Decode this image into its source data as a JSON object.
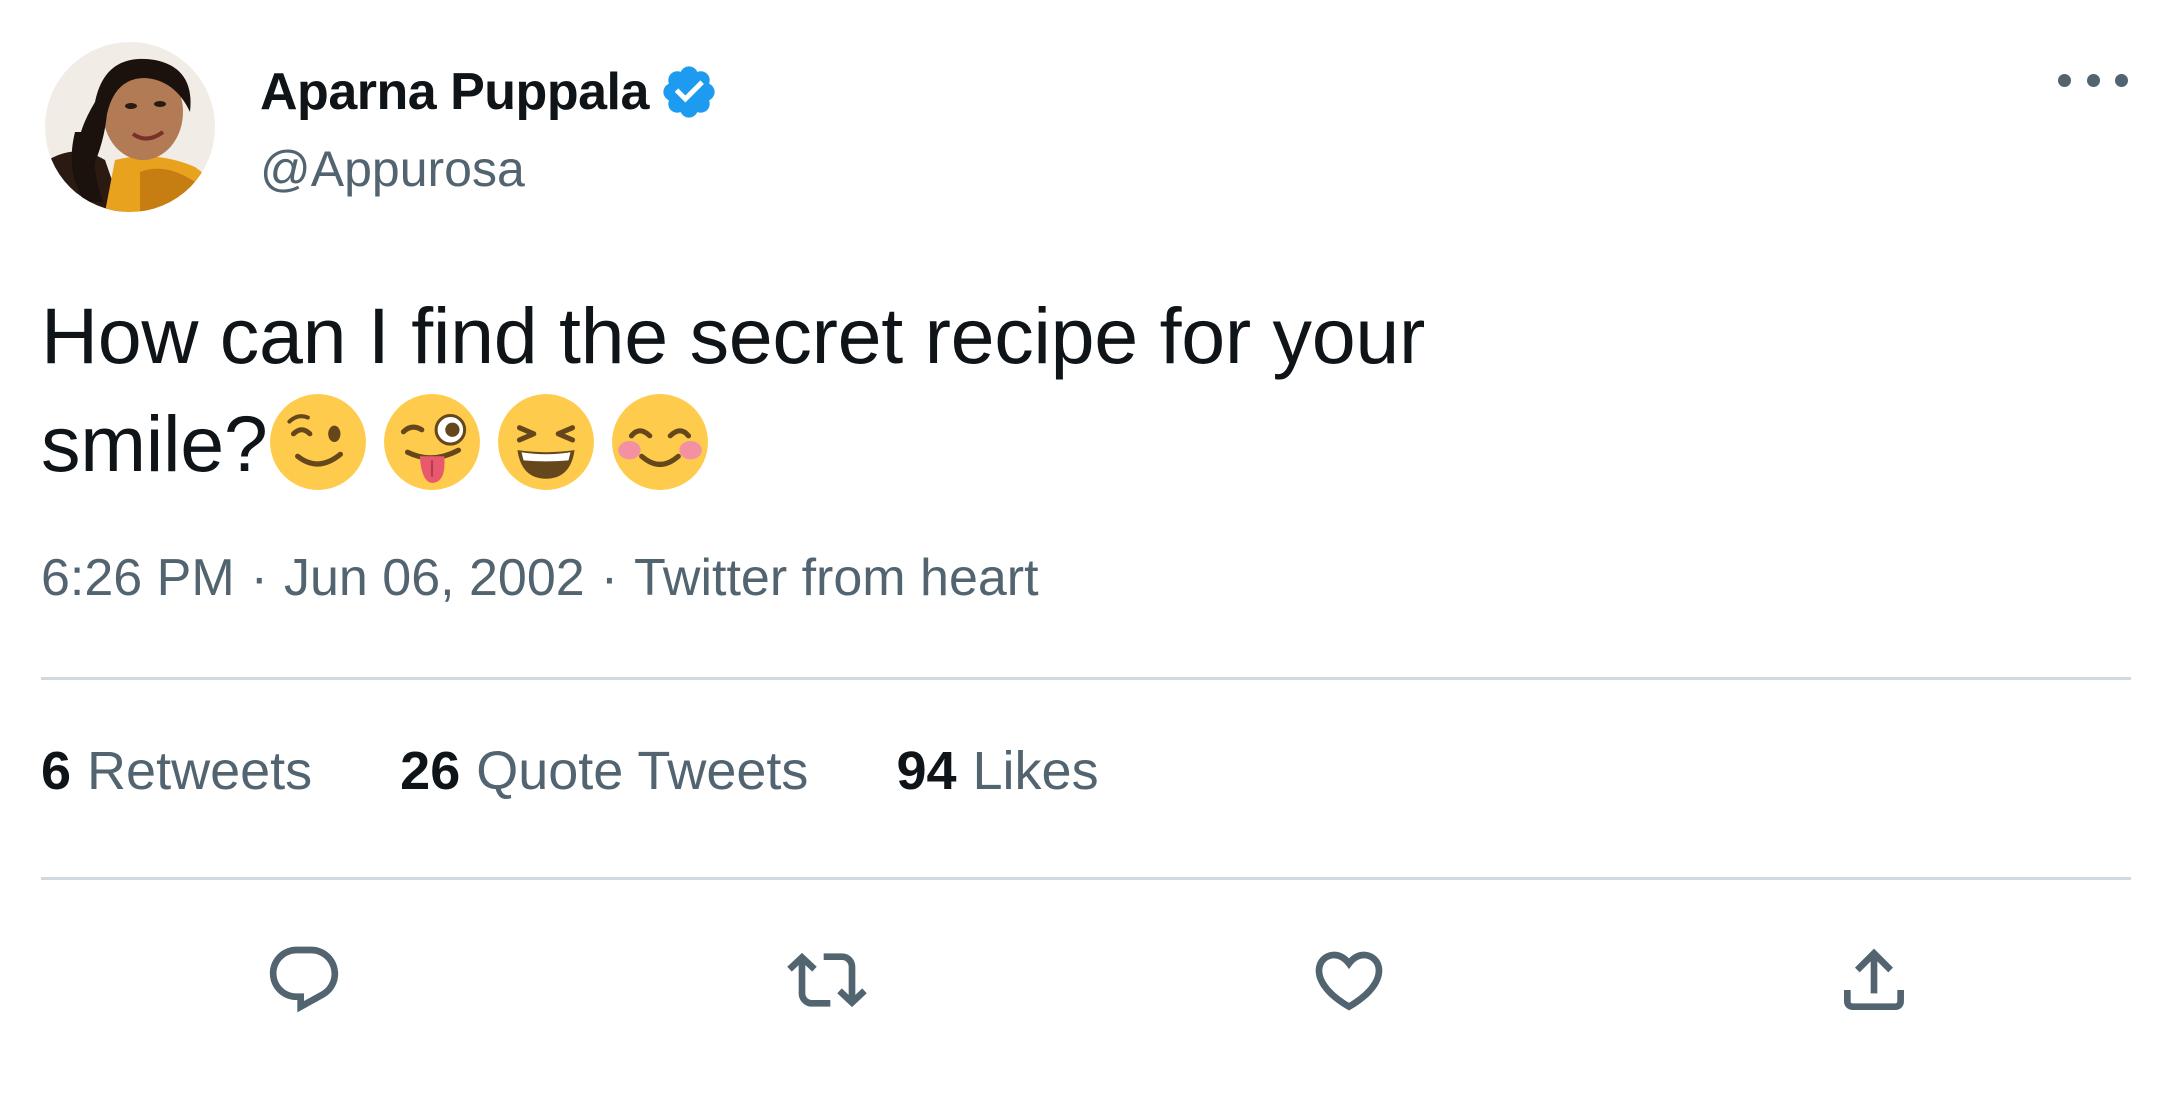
{
  "user": {
    "display_name": "Aparna Puppala",
    "handle": "@Appurosa",
    "verified": true,
    "avatar_icon": "profile-photo"
  },
  "tweet": {
    "text": "How can I find the secret recipe for your smile?",
    "emojis": [
      "winking-face",
      "winking-face-with-tongue",
      "grinning-squinting-face",
      "smiling-face-with-smiling-eyes"
    ]
  },
  "meta": {
    "time": "6:26 PM",
    "separator": "·",
    "date": "Jun 06, 2002",
    "source": "Twitter from heart"
  },
  "stats": {
    "retweets": {
      "count": "6",
      "label": "Retweets"
    },
    "quotes": {
      "count": "26",
      "label": "Quote Tweets"
    },
    "likes": {
      "count": "94",
      "label": "Likes"
    }
  },
  "actions": [
    "reply-icon",
    "retweet-icon",
    "like-icon",
    "share-icon"
  ],
  "colors": {
    "text": "#0f1419",
    "secondary": "#536471",
    "divider": "#cfd9de",
    "verified": "#1d9bf0",
    "emoji_yellow": "#ffcb4c"
  }
}
